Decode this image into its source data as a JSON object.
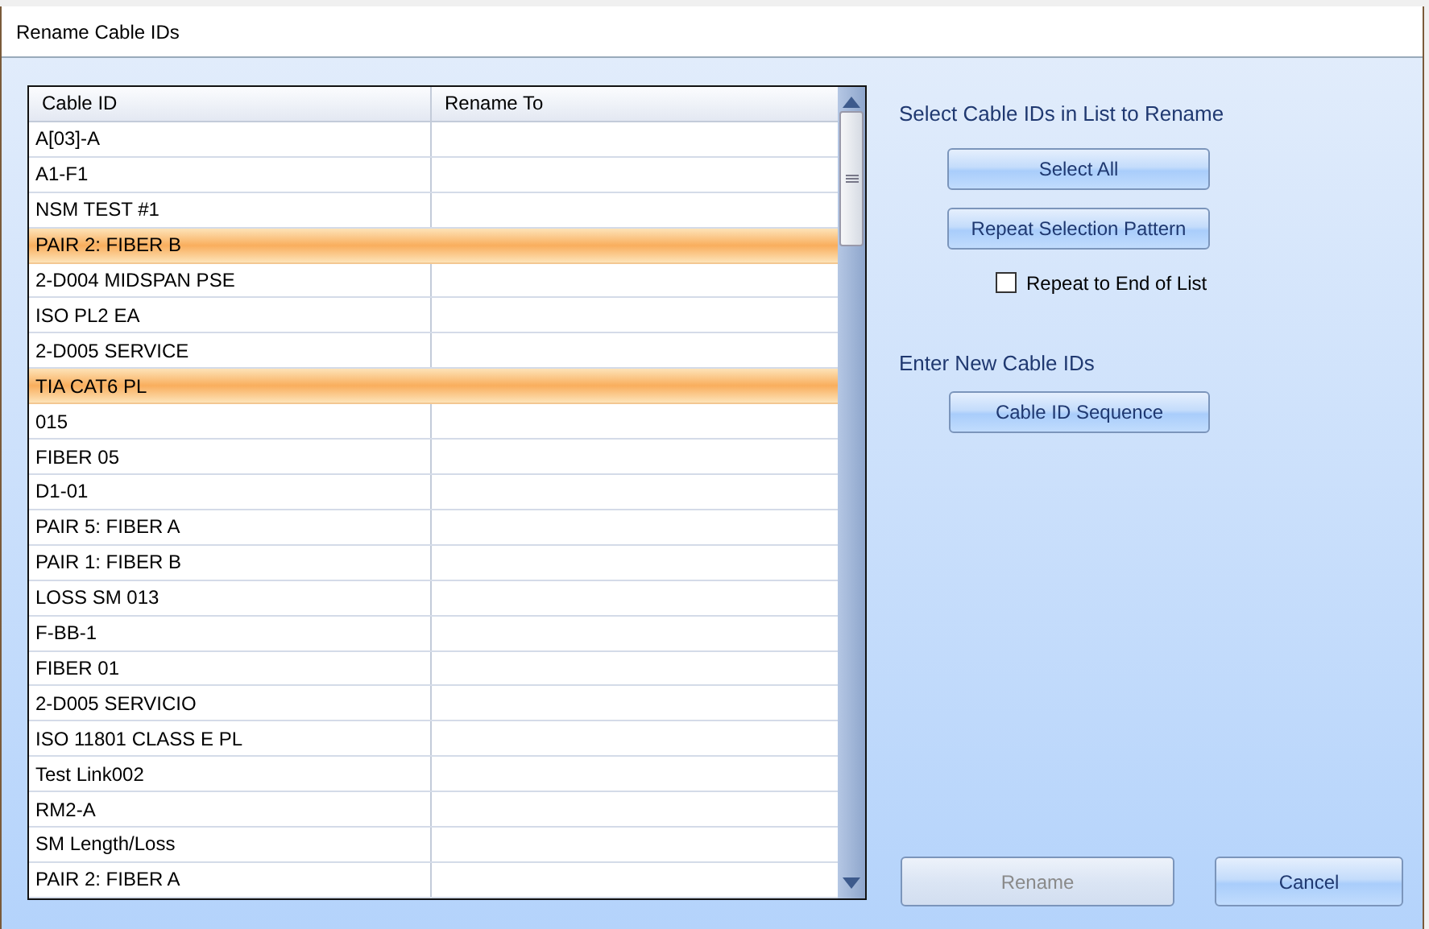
{
  "window": {
    "title": "Rename Cable IDs"
  },
  "table": {
    "columns": [
      "Cable ID",
      "Rename To"
    ],
    "rows": [
      {
        "cable_id": "A[03]-A",
        "selected": false
      },
      {
        "cable_id": "A1-F1",
        "selected": false
      },
      {
        "cable_id": "NSM TEST #1",
        "selected": false
      },
      {
        "cable_id": "PAIR 2: FIBER B",
        "selected": true
      },
      {
        "cable_id": "2-D004 MIDSPAN PSE",
        "selected": false
      },
      {
        "cable_id": "ISO PL2 EA",
        "selected": false
      },
      {
        "cable_id": "2-D005 SERVICE",
        "selected": false
      },
      {
        "cable_id": "TIA CAT6 PL",
        "selected": true
      },
      {
        "cable_id": "015",
        "selected": false
      },
      {
        "cable_id": "FIBER 05",
        "selected": false
      },
      {
        "cable_id": "D1-01",
        "selected": false
      },
      {
        "cable_id": "PAIR 5: FIBER A",
        "selected": false
      },
      {
        "cable_id": "PAIR 1: FIBER B",
        "selected": false
      },
      {
        "cable_id": "LOSS SM 013",
        "selected": false
      },
      {
        "cable_id": "F-BB-1",
        "selected": false
      },
      {
        "cable_id": "FIBER 01",
        "selected": false
      },
      {
        "cable_id": "2-D005 SERVICIO",
        "selected": false
      },
      {
        "cable_id": "ISO 11801 CLASS E PL",
        "selected": false
      },
      {
        "cable_id": "Test Link002",
        "selected": false
      },
      {
        "cable_id": "RM2-A",
        "selected": false
      },
      {
        "cable_id": "SM Length/Loss",
        "selected": false
      },
      {
        "cable_id": "PAIR 2: FIBER A",
        "selected": false
      }
    ]
  },
  "select_section": {
    "label": "Select Cable IDs in List to Rename",
    "buttons": [
      "Select All",
      "Repeat Selection Pattern"
    ],
    "checkbox": {
      "label": "Repeat to End of List",
      "checked": false
    }
  },
  "enter_section": {
    "label": "Enter New Cable IDs",
    "button": "Cable ID Sequence"
  },
  "footer": [
    {
      "label": "Rename",
      "disabled": true
    },
    {
      "label": "Cancel",
      "disabled": false
    }
  ]
}
